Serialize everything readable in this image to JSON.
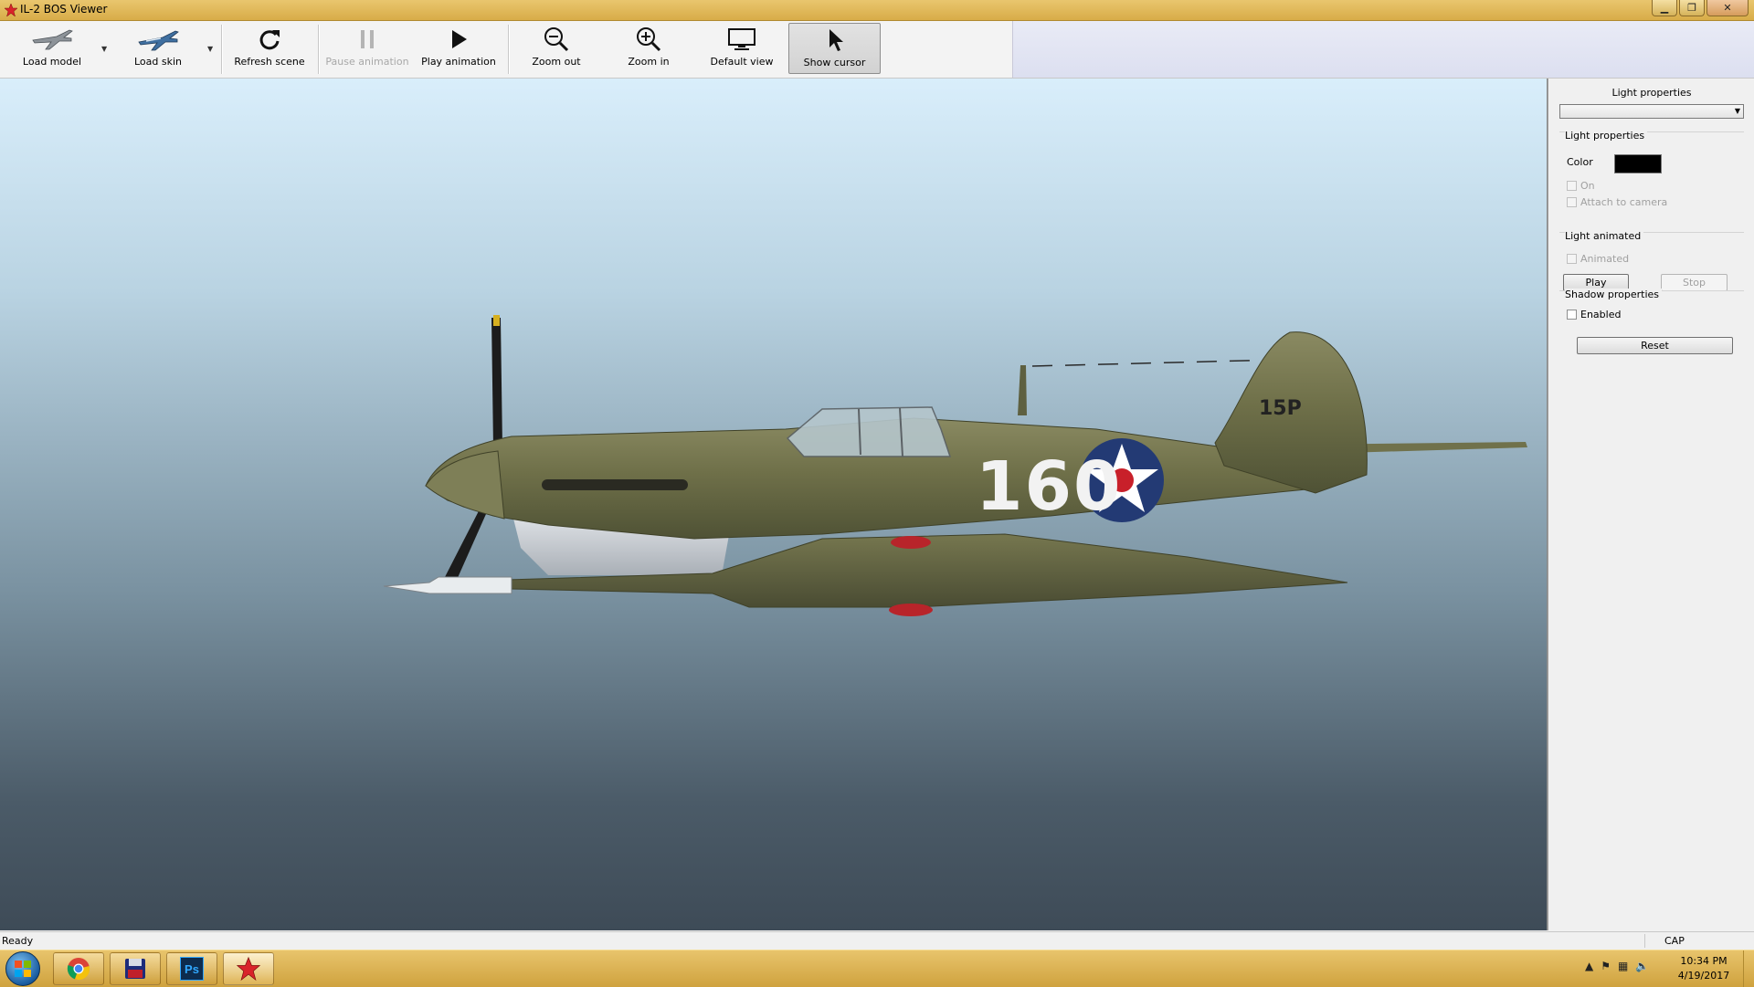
{
  "window": {
    "title": "IL-2 BOS Viewer"
  },
  "toolbar": {
    "load_model": "Load model",
    "load_skin": "Load skin",
    "refresh_scene": "Refresh scene",
    "pause_animation": "Pause animation",
    "play_animation": "Play animation",
    "zoom_out": "Zoom out",
    "zoom_in": "Zoom in",
    "default_view": "Default view",
    "show_cursor": "Show cursor"
  },
  "viewport": {
    "tail_code": "15P",
    "fuselage_number": "160"
  },
  "panel": {
    "title": "Light properties",
    "combo_value": "",
    "light_group": "Light properties",
    "color_label": "Color",
    "color_value": "#000000",
    "on_label": "On",
    "attach_label": "Attach to camera",
    "animated_group": "Light animated",
    "animated_label": "Animated",
    "play_label": "Play",
    "stop_label": "Stop",
    "shadow_group": "Shadow properties",
    "enabled_label": "Enabled",
    "reset_label": "Reset"
  },
  "statusbar": {
    "status": "Ready",
    "cap": "CAP"
  },
  "taskbar": {
    "apps": [
      "chrome-icon",
      "floppy-disk-icon",
      "photoshop-icon",
      "red-star-icon"
    ],
    "photoshop_label": "Ps",
    "time": "10:34 PM",
    "date": "4/19/2017"
  }
}
